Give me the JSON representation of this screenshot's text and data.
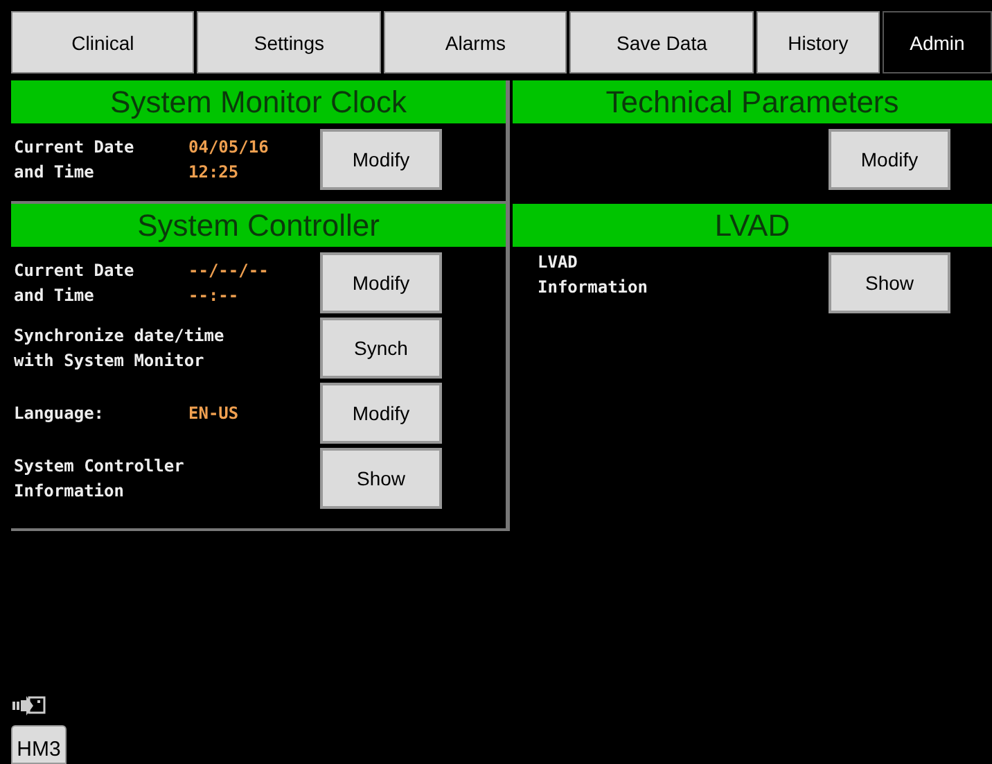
{
  "tabs": [
    {
      "label": "Clinical",
      "selected": false
    },
    {
      "label": "Settings",
      "selected": false
    },
    {
      "label": "Alarms",
      "selected": false
    },
    {
      "label": "Save Data",
      "selected": false
    },
    {
      "label": "History",
      "selected": false
    },
    {
      "label": "Admin",
      "selected": true
    }
  ],
  "panels": [
    {
      "title": "System Monitor Clock",
      "rows": [
        {
          "labels": [
            "Current Date",
            "and Time"
          ],
          "values": [
            "04/05/16",
            "12:25"
          ],
          "button": "Modify"
        }
      ]
    },
    {
      "title": "Technical Parameters",
      "rows": [
        {
          "labels": [],
          "values": [],
          "button": "Modify"
        }
      ]
    },
    {
      "title": "System Controller",
      "rows": [
        {
          "labels": [
            "Current Date",
            "and Time"
          ],
          "values": [
            "--/--/--",
            "--:--"
          ],
          "button": "Modify"
        },
        {
          "labels": [
            "Synchronize date/time",
            "with System Monitor"
          ],
          "values": [],
          "button": "Synch"
        },
        {
          "labels": [
            "Language:"
          ],
          "values": [
            "EN-US"
          ],
          "button": "Modify"
        },
        {
          "labels": [
            "System Controller",
            "Information"
          ],
          "values": [],
          "button": "Show"
        }
      ]
    },
    {
      "title": "LVAD",
      "rows": [
        {
          "labels": [
            "LVAD",
            "Information"
          ],
          "values": [],
          "button": "Show"
        }
      ]
    }
  ],
  "footer_button": "HM3"
}
